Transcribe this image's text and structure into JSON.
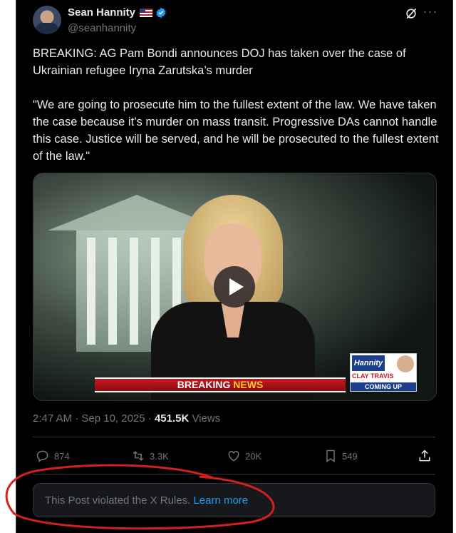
{
  "author": {
    "name": "Sean Hannity",
    "handle": "@seanhannity"
  },
  "post": {
    "text": "BREAKING: AG Pam Bondi announces DOJ has taken over the case of Ukrainian refugee Iryna Zarutska’s murder\n\n\"We are going to prosecute him to the fullest extent of the law. We have taken the case because it’s murder on mass transit. Progressive DAs cannot handle this case. Justice will be served, and he will be prosecuted to the fullest extent of the law.\""
  },
  "video": {
    "banner_left": "BREAKING ",
    "banner_right": "NEWS",
    "promo_logo": "Hannity",
    "promo_name": "CLAY TRAVIS",
    "promo_sub": "COMING UP"
  },
  "meta": {
    "time": "2:47 AM · Sep 10, 2025 · ",
    "views": "451.5K",
    "views_label": " Views"
  },
  "actions": {
    "replies": "874",
    "reposts": "3.3K",
    "likes": "20K",
    "bookmarks": "549"
  },
  "notice": {
    "text": "This Post violated the X Rules. ",
    "link": "Learn more"
  },
  "icons": [
    "verified-badge-icon",
    "grok-icon",
    "more-icon",
    "reply-icon",
    "repost-icon",
    "like-icon",
    "bookmark-icon",
    "share-icon"
  ],
  "colors": {
    "accent": "#1d9bf0",
    "muted": "#71767b",
    "text": "#e7e9ea",
    "background": "#000000",
    "annotation": "#d21f1f"
  }
}
